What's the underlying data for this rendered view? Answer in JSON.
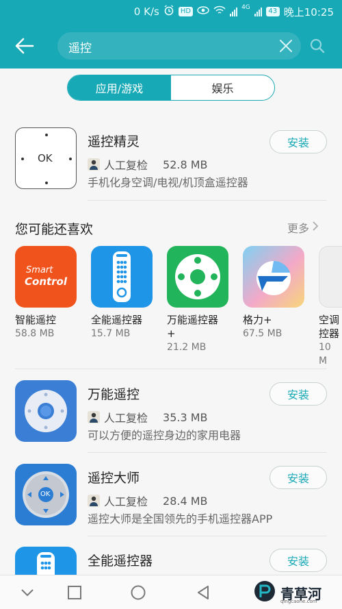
{
  "status_bar": {
    "speed": "0 K/s",
    "hd_badge": "HD",
    "network": "4G",
    "battery": "43",
    "time": "晚上10:25"
  },
  "header": {
    "search_query": "遥控",
    "back_icon": "arrow-left-icon",
    "clear_icon": "close-icon",
    "search_icon": "search-icon",
    "accent_color": "#18a9b6"
  },
  "tabs": [
    {
      "label": "应用/游戏",
      "active": true
    },
    {
      "label": "娱乐",
      "active": false
    }
  ],
  "top_result": {
    "name": "遥控精灵",
    "verified": "人工复检",
    "size": "52.8 MB",
    "description": "手机化身空调/电视/机顶盒遥控器",
    "install_label": "安装",
    "icon_text": "OK"
  },
  "recommendations": {
    "title": "您可能还喜欢",
    "more_label": "更多",
    "items": [
      {
        "name": "智能遥控",
        "size": "58.8 MB",
        "icon_text_1": "Smart",
        "icon_text_2": "Control"
      },
      {
        "name": "全能遥控器",
        "size": "15.7 MB"
      },
      {
        "name": "万能遥控器\n+",
        "size": "21.2 MB"
      },
      {
        "name": "格力+",
        "size": "67.5 MB"
      },
      {
        "name": "空调\n控器",
        "size": "10 M"
      }
    ]
  },
  "results": [
    {
      "name": "万能遥控",
      "verified": "人工复检",
      "size": "35.3 MB",
      "description": "可以方便的遥控身边的家用电器",
      "install_label": "安装"
    },
    {
      "name": "遥控大师",
      "verified": "人工复检",
      "size": "28.4 MB",
      "description": "遥控大师是全国领先的手机遥控器APP",
      "install_label": "安装",
      "icon_text": "OK"
    },
    {
      "name": "全能遥控器",
      "install_label": "安装"
    }
  ],
  "watermark": {
    "text": "青草河",
    "sub": "qingcaohe.com"
  }
}
